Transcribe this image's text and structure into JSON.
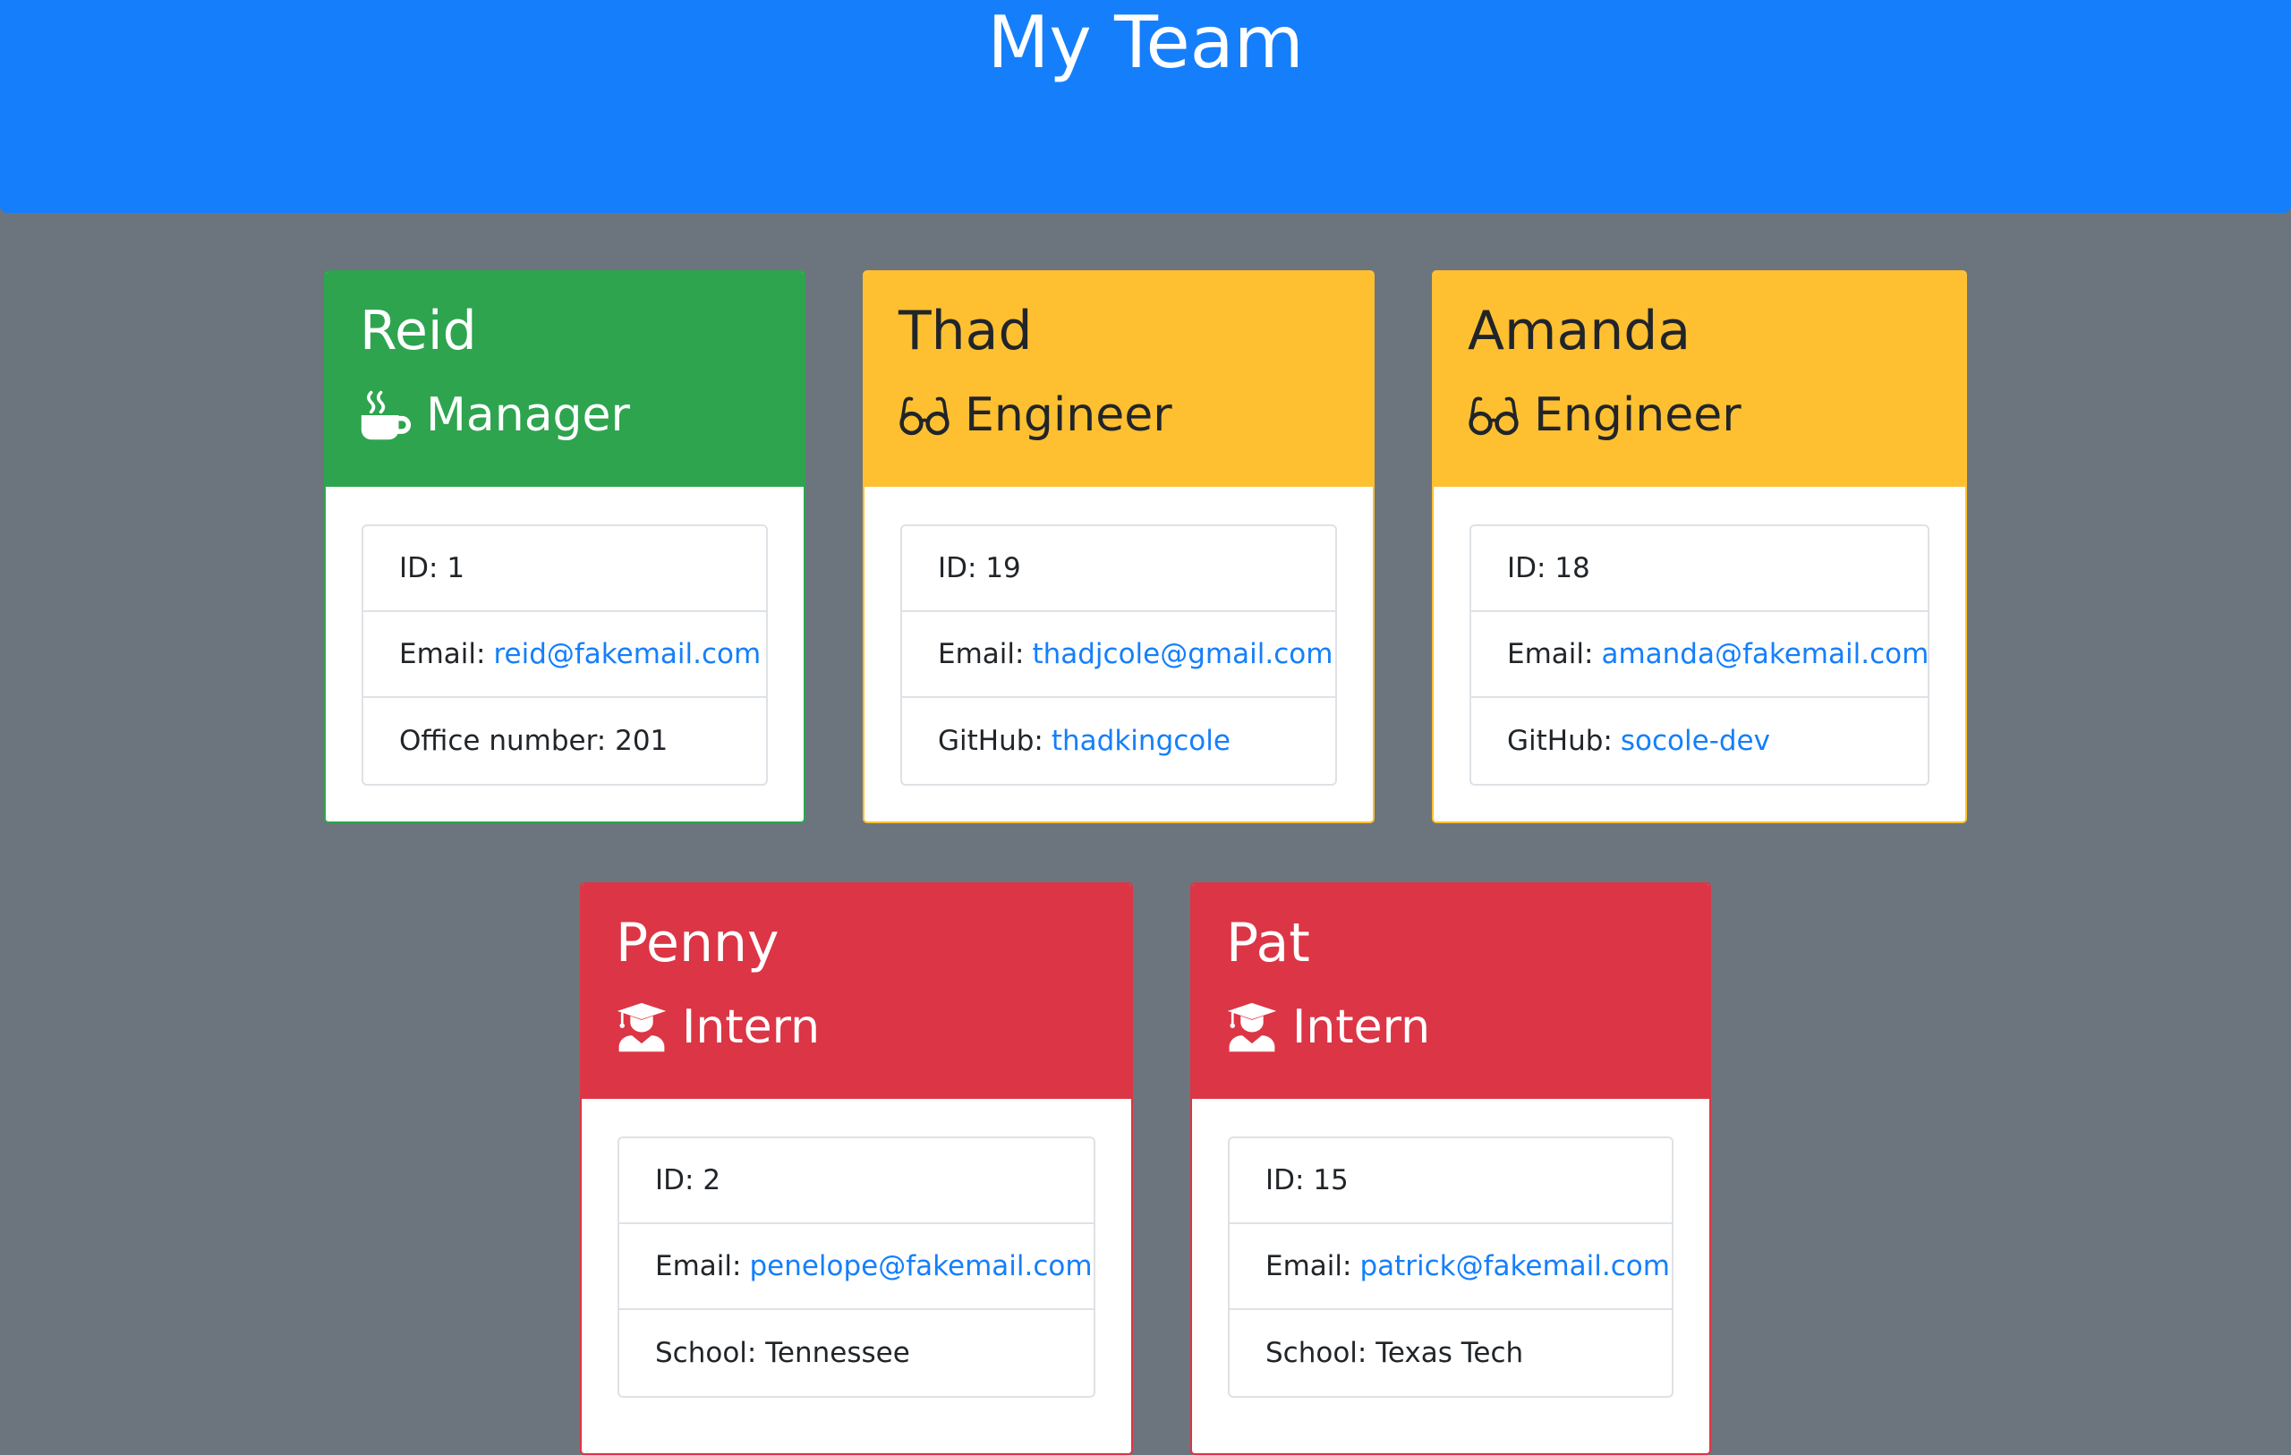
{
  "header": {
    "title": "My Team"
  },
  "colors": {
    "header_bg": "#157ffb",
    "page_bg": "#6c757d",
    "manager": "#2ea44f",
    "engineer": "#fec031",
    "intern": "#dc3545",
    "link": "#157ffb"
  },
  "cards": [
    {
      "name": "Reid",
      "role": "Manager",
      "icon": "coffee-mug-icon",
      "id_label": "ID:",
      "id": "1",
      "email_label": "Email:",
      "email": "reid@fakemail.com",
      "extra_label": "Office number:",
      "extra": "201"
    },
    {
      "name": "Thad",
      "role": "Engineer",
      "icon": "glasses-icon",
      "id_label": "ID:",
      "id": "19",
      "email_label": "Email:",
      "email": "thadjcole@gmail.com",
      "extra_label": "GitHub:",
      "extra": "thadkingcole"
    },
    {
      "name": "Amanda",
      "role": "Engineer",
      "icon": "glasses-icon",
      "id_label": "ID:",
      "id": "18",
      "email_label": "Email:",
      "email": "amanda@fakemail.com",
      "extra_label": "GitHub:",
      "extra": "socole-dev"
    },
    {
      "name": "Penny",
      "role": "Intern",
      "icon": "graduate-icon",
      "id_label": "ID:",
      "id": "2",
      "email_label": "Email:",
      "email": "penelope@fakemail.com",
      "extra_label": "School:",
      "extra": "Tennessee"
    },
    {
      "name": "Pat",
      "role": "Intern",
      "icon": "graduate-icon",
      "id_label": "ID:",
      "id": "15",
      "email_label": "Email:",
      "email": "patrick@fakemail.com",
      "extra_label": "School:",
      "extra": "Texas Tech"
    }
  ]
}
